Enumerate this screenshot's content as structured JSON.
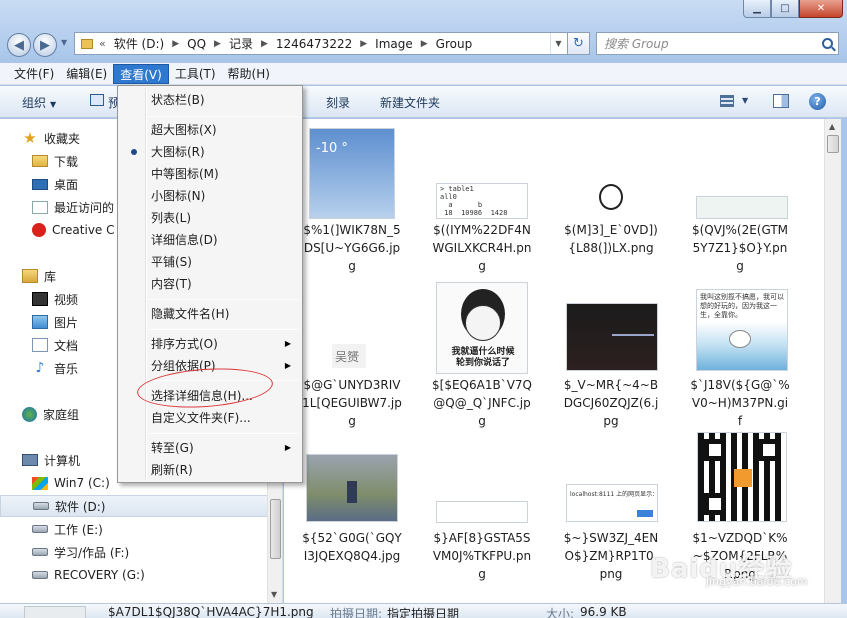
{
  "address": {
    "chevron": "«",
    "crumbs": [
      "软件 (D:)",
      "QQ",
      "记录",
      "1246473222",
      "Image",
      "Group"
    ]
  },
  "search": {
    "placeholder": "搜索 Group"
  },
  "menubar": [
    "文件(F)",
    "编辑(E)",
    "查看(V)",
    "工具(T)",
    "帮助(H)"
  ],
  "toolbar": {
    "organize": "组织",
    "preview": "预",
    "burn": "刻录",
    "new_folder": "新建文件夹"
  },
  "nav": {
    "favorites": "收藏夹",
    "downloads": "下载",
    "desktop": "桌面",
    "recent": "最近访问的",
    "creative": "Creative C",
    "libraries": "库",
    "video": "视频",
    "pictures": "图片",
    "documents": "文档",
    "music": "音乐",
    "homegroup": "家庭组",
    "computer": "计算机",
    "drive_c": "Win7 (C:)",
    "drive_d": "软件 (D:)",
    "drive_e": "工作 (E:)",
    "drive_f": "学习/作品 (F:)",
    "drive_g": "RECOVERY (G:)"
  },
  "view_menu": {
    "statusbar": "状态栏(B)",
    "extra_large": "超大图标(X)",
    "large": "大图标(R)",
    "medium": "中等图标(M)",
    "small": "小图标(N)",
    "list": "列表(L)",
    "details": "详细信息(D)",
    "tiles": "平铺(S)",
    "content": "内容(T)",
    "hide_ext": "隐藏文件名(H)",
    "sort_by": "排序方式(O)",
    "group_by": "分组依据(P)",
    "choose_details": "选择详细信息(H)...",
    "customize": "自定义文件夹(F)...",
    "go_to": "转至(G)",
    "refresh": "刷新(R)"
  },
  "files": [
    {
      "name": "$%1(]WIK78N_5DS[U~YG6G6.jpg"
    },
    {
      "name": "$((IYM%22DF4NWGILXKCR4H.png"
    },
    {
      "name": "$(M]3]_E`0VD]){L88(])LX.png"
    },
    {
      "name": "$(QVJ%(2E(GTM5Y7Z1}$O}Y.png"
    },
    {
      "name": "$@G`UNYD3RIV1L[QEGUIBW7.jpg"
    },
    {
      "name": "$[$EQ6A1B`V7Q@Q@_Q`JNFC.jpg"
    },
    {
      "name": "$_V~MR{~4~BDGCJ60ZQJZ(6.jpg"
    },
    {
      "name": "$`J18V(${G@`%V0~H)M37PN.gif"
    },
    {
      "name": "${52`G0G(`GQYI3JQEXQ8Q4.jpg"
    },
    {
      "name": "$}AF[8}GSTA5SVM0J%TKFPU.png"
    },
    {
      "name": "$~}SW3ZJ_4ENO$}ZM}RP1T0.png"
    },
    {
      "name": "$1~VZDQD`K%~$ZOM{2FLR%P.png"
    }
  ],
  "thumb_text": {
    "weather_temp": "-10 °",
    "table_code": "> table1\nall0\n  a      b\n 18  10986  1428",
    "wudu": "吴赟",
    "meme_caption": "我就逼什么时候\n轮到你说话了",
    "comic_text": "我叫这别揽不搞愿，我可以想的好玩的，因为我这一生，全靠你。",
    "dialog_title": "localhost:8111 上的网页显示："
  },
  "details_bar": {
    "filename": "$A7DL1$QJ38Q`HVA4AC}7H1.png",
    "date_key": "拍摄日期:",
    "date_val": "指定拍摄日期",
    "size_key": "大小:",
    "size_val": "96.9 KB"
  },
  "watermark": {
    "logo": "Baidu经验",
    "url": "jingyan.baidu.com"
  },
  "colors": {
    "accent": "#2f78cf",
    "annotation": "#d93a3a"
  }
}
